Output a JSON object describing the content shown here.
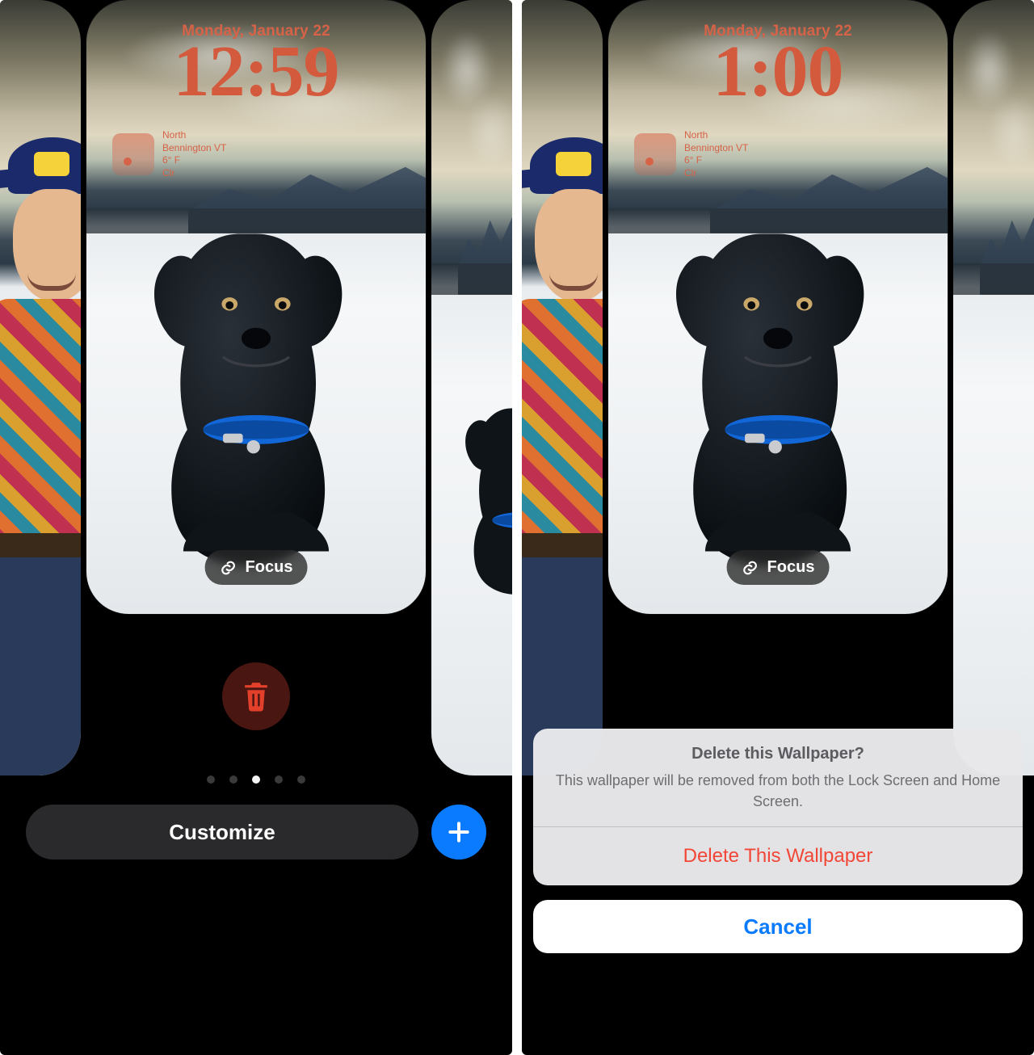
{
  "left": {
    "date": "Monday, January 22",
    "time": "12:59",
    "widget": {
      "loc": "North",
      "loc2": "Bennington VT",
      "temp": "6° F",
      "cond": "Clr"
    },
    "focus_label": "Focus",
    "customize_label": "Customize",
    "page_dots": {
      "count": 5,
      "active_index": 2
    }
  },
  "right": {
    "date": "Monday, January 22",
    "time": "1:00",
    "widget": {
      "loc": "North",
      "loc2": "Bennington VT",
      "temp": "6° F",
      "cond": "Clr"
    },
    "focus_label": "Focus",
    "sheet": {
      "title": "Delete this Wallpaper?",
      "message": "This wallpaper will be removed from both the Lock Screen and Home Screen.",
      "destructive_label": "Delete This Wallpaper",
      "cancel_label": "Cancel"
    }
  },
  "colors": {
    "accent": "#d45a3e",
    "ios_blue": "#0a7bff",
    "ios_red": "#f24636"
  }
}
